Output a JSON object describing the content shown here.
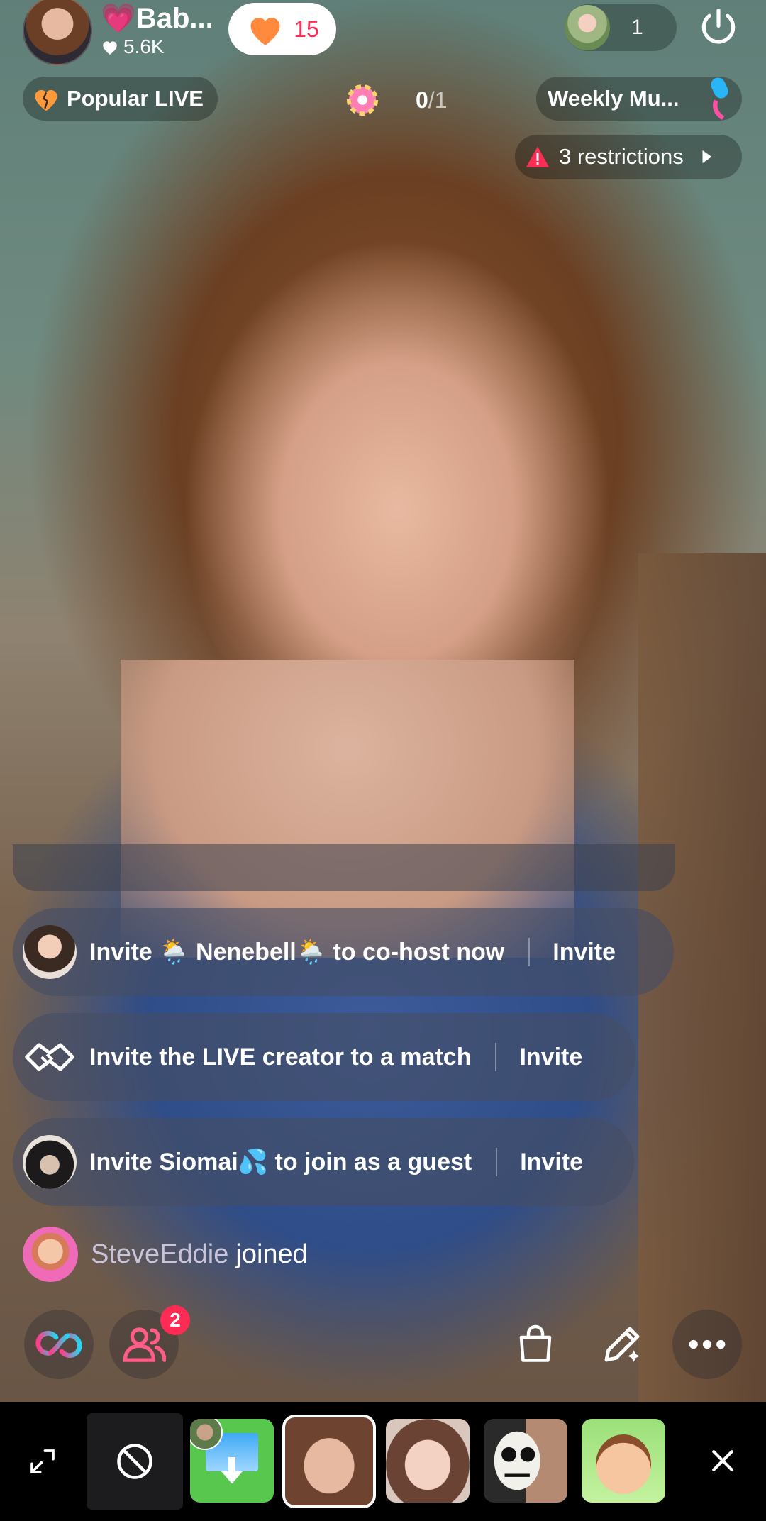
{
  "host": {
    "name": "💗Bab...",
    "likes": "5.6K",
    "follow_count": "15"
  },
  "viewers": {
    "count": "1"
  },
  "badges": {
    "popular_label": "Popular LIVE",
    "goal_current": "0",
    "goal_total": "/1",
    "weekly_label": "Weekly Mu...",
    "restrictions_label": "3 restrictions"
  },
  "chat": {
    "cards": [
      {
        "text": "Invite 🌦️ Nenebell🌦️ to co-host now",
        "action": "Invite"
      },
      {
        "text": "Invite the LIVE creator to a match",
        "action": "Invite"
      },
      {
        "text": "Invite Siomai💦 to join as a guest",
        "action": "Invite"
      }
    ],
    "joined": {
      "name": "SteveEddie",
      "verb": "joined"
    }
  },
  "actions": {
    "guests_badge": "2"
  },
  "icons": {
    "heart": "heart-icon",
    "power": "power-icon",
    "warning": "warning-icon",
    "link": "link-icon",
    "users": "users-icon",
    "bag": "shopping-bag-icon",
    "pen": "magic-pen-icon",
    "more": "more-icon",
    "expand": "expand-icon",
    "none": "no-effect-icon",
    "close": "close-icon"
  },
  "colors": {
    "accent_red": "#fe2c55",
    "follow_heart": "#ff8a3d",
    "tray_bg": "#000000"
  }
}
